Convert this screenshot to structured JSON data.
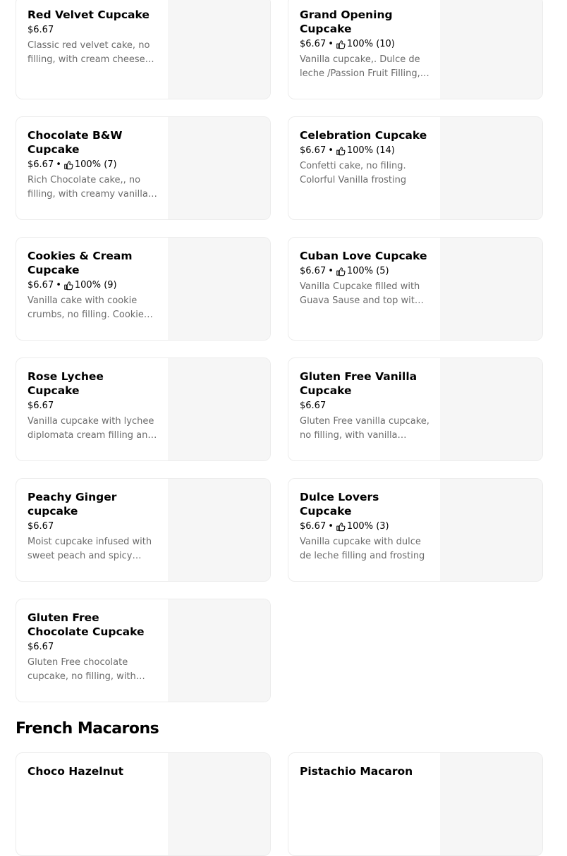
{
  "cupcake_items": [
    {
      "name": "Red Velvet Cupcake",
      "price": "$6.67",
      "rating": "",
      "desc": "Classic red velvet cake, no filling, with cream cheese frosting"
    },
    {
      "name": "Grand Opening Cupcake",
      "price": "$6.67",
      "rating": "100% (10)",
      "desc": "Vanilla cupcake,. Dulce de leche /Passion Fruit Filling, with frosting"
    },
    {
      "name": "Chocolate B&W Cupcake",
      "price": "$6.67",
      "rating": "100% (7)",
      "desc": "Rich Chocolate cake,, no filling, with creamy vanilla frosting"
    },
    {
      "name": "Celebration Cupcake",
      "price": "$6.67",
      "rating": "100% (14)",
      "desc": "Confetti cake, no filing. Colorful Vanilla frosting"
    },
    {
      "name": "Cookies & Cream Cupcake",
      "price": "$6.67",
      "rating": "100% (9)",
      "desc": "Vanilla cake with cookie crumbs, no filling. Cookies and cream frosting"
    },
    {
      "name": "Cuban Love Cupcake",
      "price": "$6.67",
      "rating": "100% (5)",
      "desc": "Vanilla Cupcake filled with Guava Sause and top with cream cheese"
    },
    {
      "name": "Rose Lychee Cupcake",
      "price": "$6.67",
      "rating": "",
      "desc": "Vanilla cupcake with lychee diplomata cream filling and rose frosting"
    },
    {
      "name": "Gluten Free Vanilla Cupcake",
      "price": "$6.67",
      "rating": "",
      "desc": "Gluten Free vanilla cupcake, no filling, with vanilla frosting"
    },
    {
      "name": "Peachy Ginger cupcake",
      "price": "$6.67",
      "rating": "",
      "desc": "Moist cupcake infused with sweet peach and spicy ginger"
    },
    {
      "name": "Dulce Lovers Cupcake",
      "price": "$6.67",
      "rating": "100% (3)",
      "desc": "Vanilla cupcake with dulce de leche filling and frosting"
    },
    {
      "name": "Gluten Free Chocolate Cupcake",
      "price": "$6.67",
      "rating": "",
      "desc": "Gluten Free chocolate cupcake, no filling, with vanilla frosting"
    }
  ],
  "section_title": "French Macarons",
  "macaron_items": [
    {
      "name": "Choco Hazelnut",
      "price": "",
      "rating": "",
      "desc": ""
    },
    {
      "name": "Pistachio Macaron",
      "price": "",
      "rating": "",
      "desc": ""
    }
  ],
  "meta_separator": "•"
}
